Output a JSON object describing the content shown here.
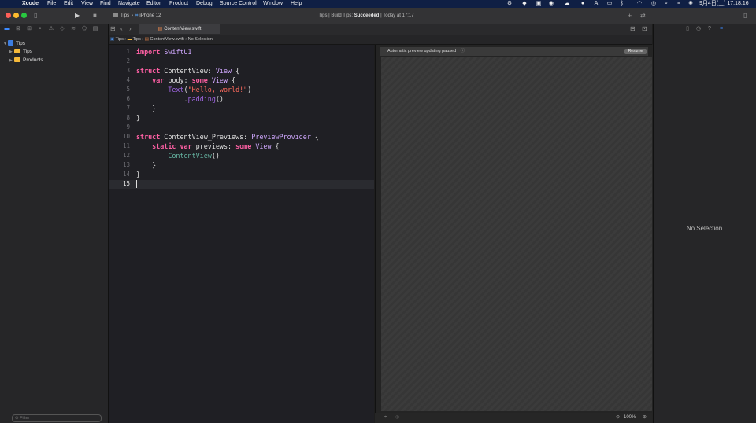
{
  "menubar": {
    "app": "Xcode",
    "items": [
      "File",
      "Edit",
      "View",
      "Find",
      "Navigate",
      "Editor",
      "Product",
      "Debug",
      "Source Control",
      "Window",
      "Help"
    ],
    "clock": "9月4日(土) 17:18:16"
  },
  "toolbar": {
    "scheme": "Tips",
    "destination": "iPhone 12",
    "activity_prefix": "Tips | Build Tips:",
    "activity_status": "Succeeded",
    "activity_time": "| Today at 17:17"
  },
  "navigator": {
    "items": [
      {
        "label": "Tips",
        "kind": "project"
      },
      {
        "label": "Tips",
        "kind": "folder"
      },
      {
        "label": "Products",
        "kind": "folder"
      }
    ],
    "filter_placeholder": "Filter"
  },
  "editor": {
    "tab_label": "ContentView.swift",
    "breadcrumb": [
      "Tips",
      "Tips",
      "ContentView.swift",
      "No Selection"
    ],
    "current_line": 15,
    "lines": [
      "import SwiftUI",
      "",
      "struct ContentView: View {",
      "    var body: some View {",
      "        Text(\"Hello, world!\")",
      "            .padding()",
      "    }",
      "}",
      "",
      "struct ContentView_Previews: PreviewProvider {",
      "    static var previews: some View {",
      "        ContentView()",
      "    }",
      "}",
      ""
    ]
  },
  "canvas": {
    "message": "Automatic preview updating paused",
    "resume_label": "Resume",
    "zoom": "100%"
  },
  "inspector": {
    "empty_label": "No Selection"
  }
}
